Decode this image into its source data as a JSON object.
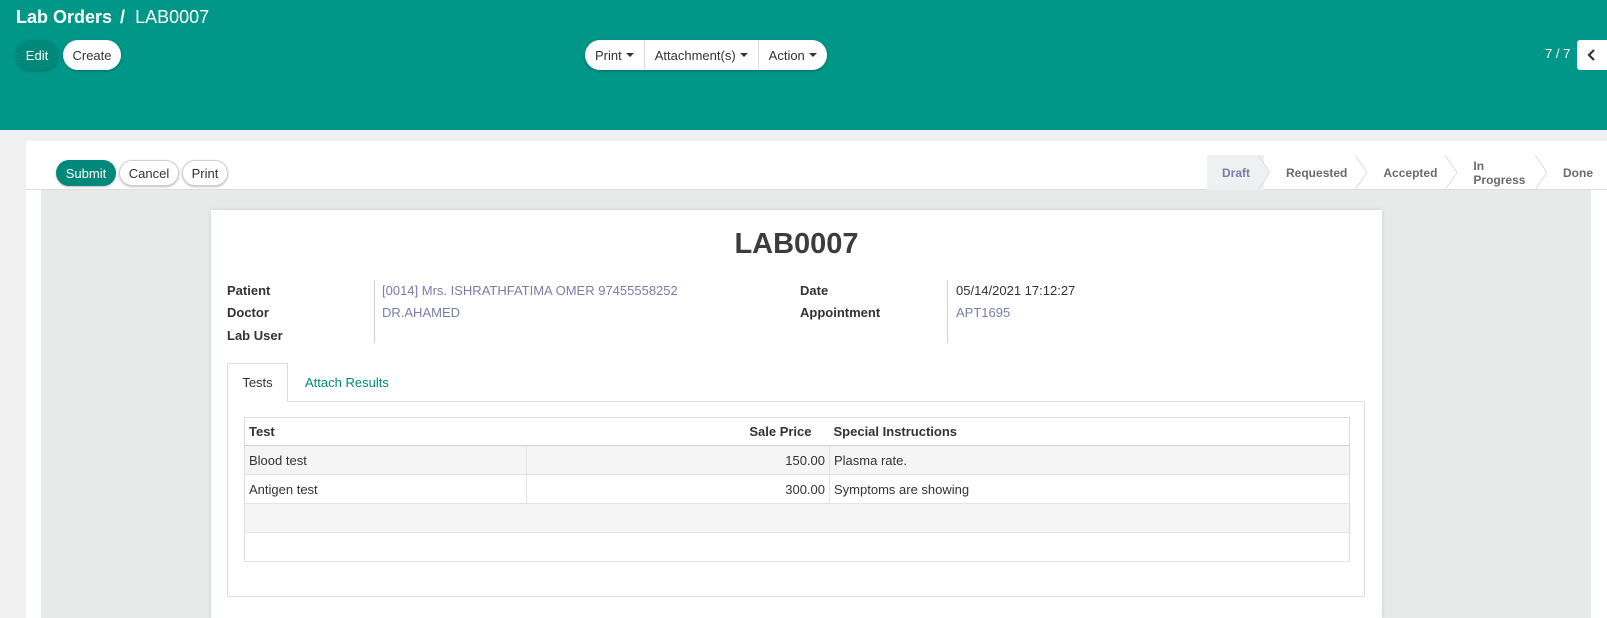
{
  "breadcrumb": {
    "parent": "Lab Orders",
    "separator": "/",
    "current": "LAB0007"
  },
  "toolbar": {
    "edit_label": "Edit",
    "create_label": "Create",
    "print_label": "Print",
    "attachments_label": "Attachment(s)",
    "action_label": "Action"
  },
  "pager": {
    "value": "7 / 7"
  },
  "statusbar": {
    "submit_label": "Submit",
    "cancel_label": "Cancel",
    "print_label": "Print",
    "stages": [
      "Draft",
      "Requested",
      "Accepted",
      "In Progress",
      "Done"
    ],
    "active_stage": "Draft"
  },
  "record": {
    "title": "LAB0007",
    "fields_left": [
      {
        "label": "Patient",
        "value": "[0014] Mrs. ISHRATHFATIMA OMER 97455558252"
      },
      {
        "label": "Doctor",
        "value": "DR.AHAMED"
      },
      {
        "label": "Lab User",
        "value": ""
      }
    ],
    "fields_right": [
      {
        "label": "Date",
        "value": "05/14/2021 17:12:27"
      },
      {
        "label": "Appointment",
        "value": "APT1695"
      }
    ]
  },
  "tabs": [
    {
      "label": "Tests",
      "active": true
    },
    {
      "label": "Attach Results",
      "active": false
    }
  ],
  "tests_table": {
    "columns": [
      "Test",
      "Sale Price",
      "Special Instructions"
    ],
    "rows": [
      {
        "test": "Blood test",
        "sale_price": "150.00",
        "instructions": "Plasma rate."
      },
      {
        "test": "Antigen test",
        "sale_price": "300.00",
        "instructions": "Symptoms are showing"
      }
    ]
  },
  "colors": {
    "primary": "#009688",
    "button": "#00897b",
    "link": "#7c7bad"
  }
}
